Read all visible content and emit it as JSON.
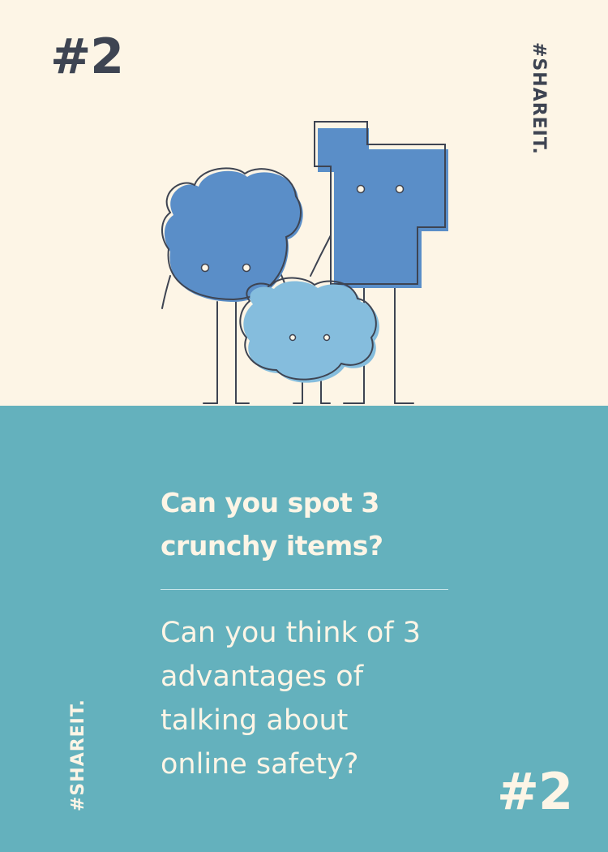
{
  "card": {
    "number": "#2",
    "hashtag": "#SHAREIT.",
    "question_primary": "Can you spot 3 crunchy items?",
    "question_secondary": "Can you think of 3 advantages of talking about online safety?",
    "colors": {
      "cream": "#fdf5e6",
      "teal": "#64b1bd",
      "dark": "#3e4452",
      "blue": "#5a8ec8",
      "light_blue": "#85bddd"
    }
  }
}
